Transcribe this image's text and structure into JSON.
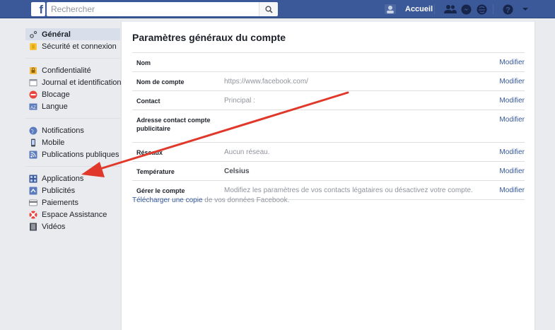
{
  "topbar": {
    "logo": "f",
    "search_placeholder": "Rechercher",
    "home_label": "Accueil"
  },
  "sidebar": {
    "groups": [
      [
        {
          "label": "Général",
          "icon": "gear-icon"
        },
        {
          "label": "Sécurité et connexion",
          "icon": "shield-icon"
        }
      ],
      [
        {
          "label": "Confidentialité",
          "icon": "lock-icon"
        },
        {
          "label": "Journal et identification",
          "icon": "timeline-icon"
        },
        {
          "label": "Blocage",
          "icon": "block-icon"
        },
        {
          "label": "Langue",
          "icon": "language-icon"
        }
      ],
      [
        {
          "label": "Notifications",
          "icon": "globe-icon"
        },
        {
          "label": "Mobile",
          "icon": "mobile-icon"
        },
        {
          "label": "Publications publiques",
          "icon": "rss-icon"
        }
      ],
      [
        {
          "label": "Applications",
          "icon": "apps-icon"
        },
        {
          "label": "Publicités",
          "icon": "ads-icon"
        },
        {
          "label": "Paiements",
          "icon": "card-icon"
        },
        {
          "label": "Espace Assistance",
          "icon": "lifebuoy-icon"
        },
        {
          "label": "Vidéos",
          "icon": "film-icon"
        }
      ]
    ]
  },
  "main": {
    "title": "Paramètres généraux du compte",
    "edit_label": "Modifier",
    "rows": [
      {
        "key": "Nom",
        "value": ""
      },
      {
        "key": "Nom de compte",
        "value": "https://www.facebook.com/"
      },
      {
        "key": "Contact",
        "value": "Principal :"
      },
      {
        "key": "Adresse contact compte publicitaire",
        "value": ""
      },
      {
        "key": "Réseaux",
        "value": "Aucun réseau."
      },
      {
        "key": "Température",
        "value": "Celsius"
      },
      {
        "key": "Gérer le compte",
        "value": "Modifiez les paramètres de vos contacts légataires ou désactivez votre compte."
      }
    ],
    "download_link": "Télécharger une copie",
    "download_suffix": " de vos données Facebook."
  },
  "colors": {
    "brand": "#3b5998",
    "link": "#365899",
    "annotation_arrow": "#e0392b"
  }
}
